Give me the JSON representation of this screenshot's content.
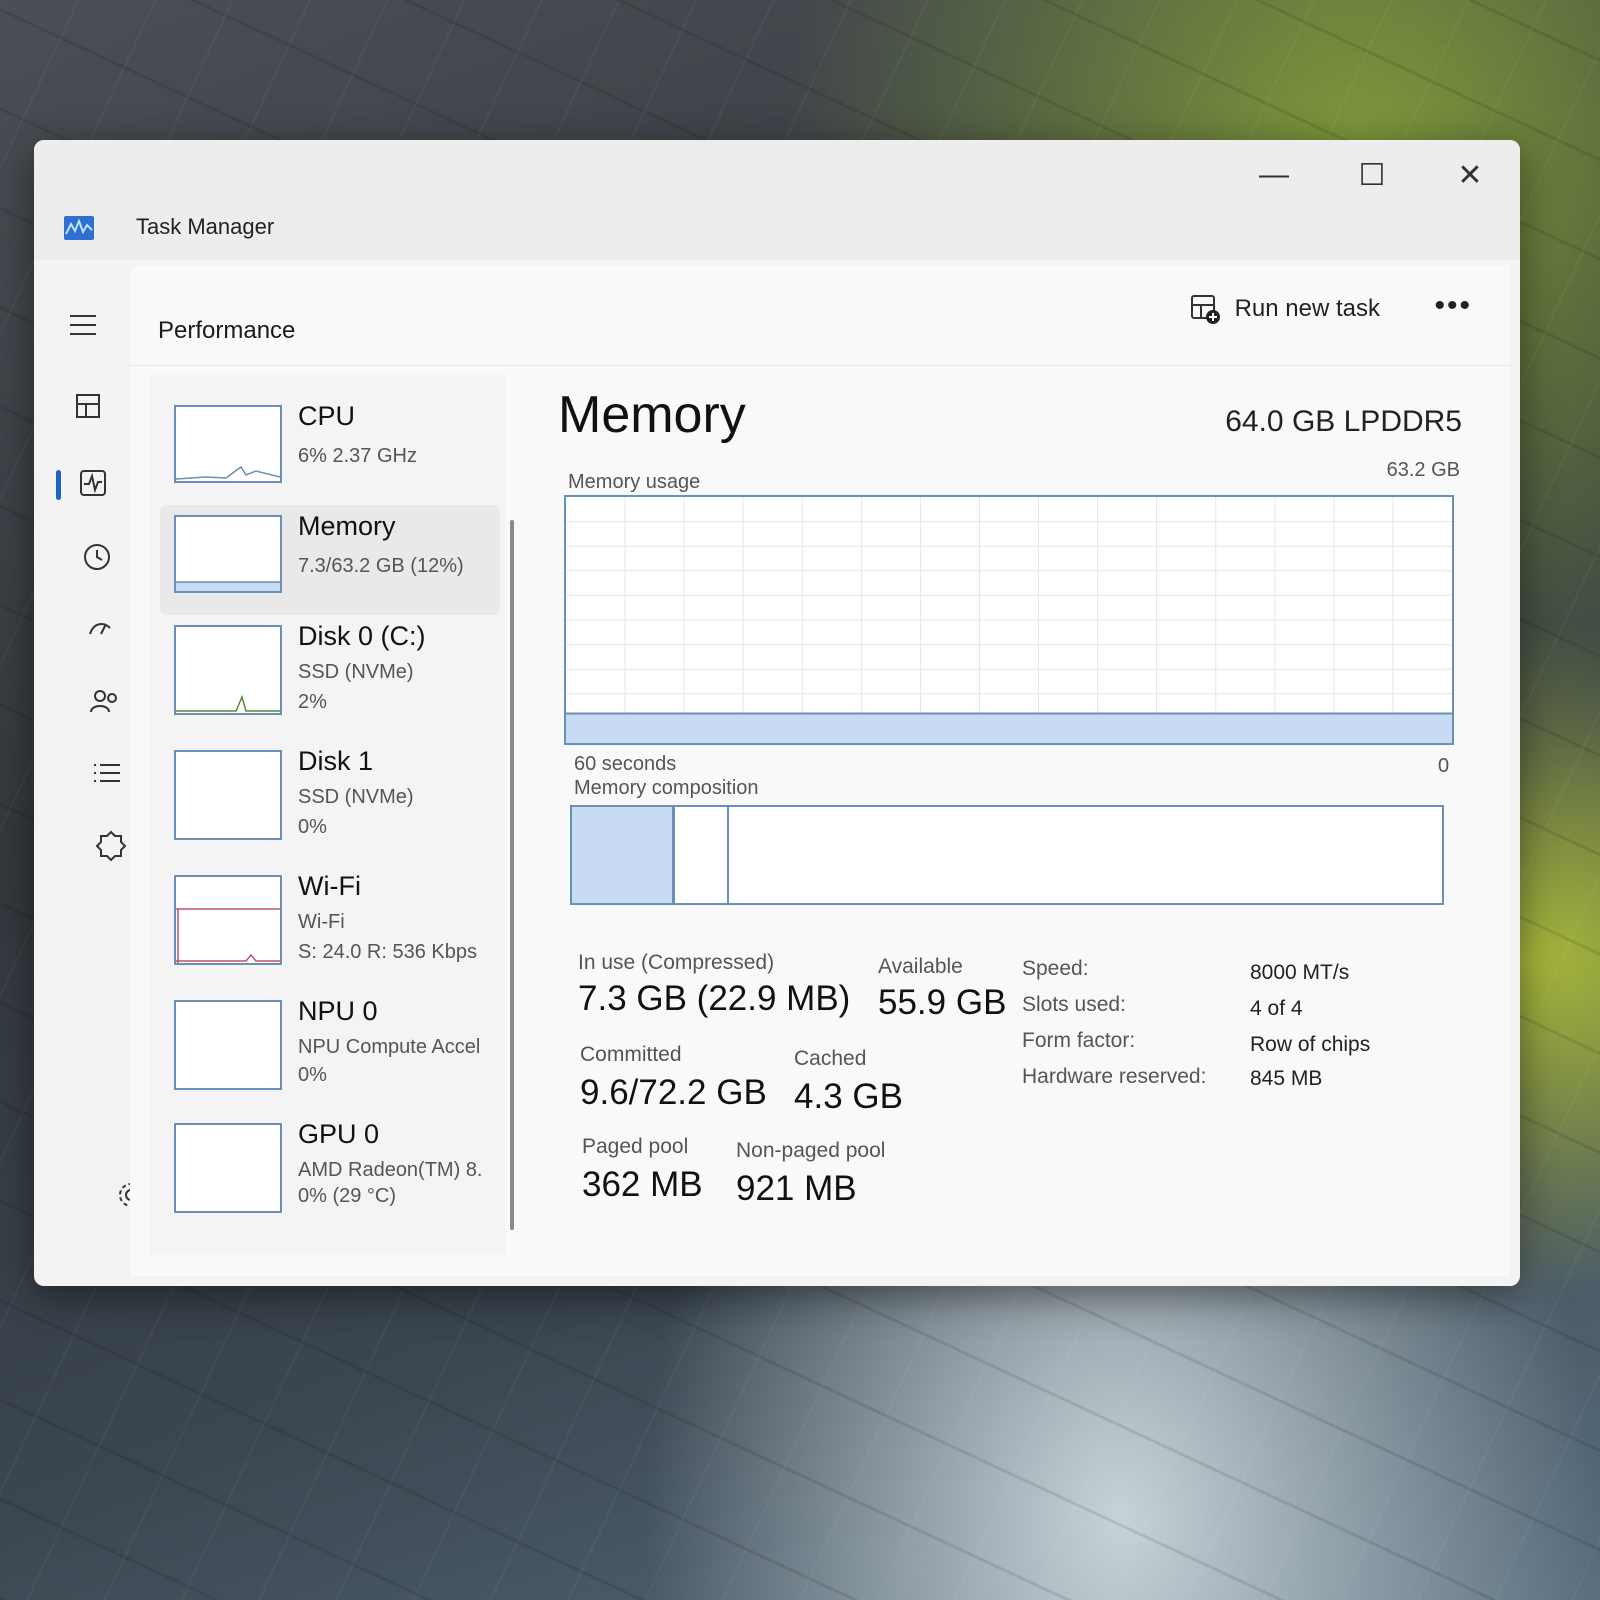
{
  "app": {
    "title": "Task Manager"
  },
  "window_controls": {
    "minimize": "—",
    "maximize": "☐",
    "close": "✕"
  },
  "toolbar": {
    "page_title": "Performance",
    "run_new_task": "Run new task",
    "more": "•••"
  },
  "nav": {
    "items": [
      {
        "name": "processes",
        "icon": "processes-icon"
      },
      {
        "name": "performance",
        "icon": "performance-icon",
        "active": true
      },
      {
        "name": "app-history",
        "icon": "app-history-icon"
      },
      {
        "name": "startup-apps",
        "icon": "startup-icon"
      },
      {
        "name": "users",
        "icon": "users-icon"
      },
      {
        "name": "details",
        "icon": "details-icon"
      },
      {
        "name": "services",
        "icon": "services-icon"
      }
    ],
    "settings_icon": "settings-icon"
  },
  "perf_list": [
    {
      "id": "cpu",
      "title": "CPU",
      "sub1": "6% 2.37 GHz",
      "sub2": ""
    },
    {
      "id": "memory",
      "title": "Memory",
      "sub1": "7.3/63.2 GB (12%)",
      "sub2": "",
      "selected": true
    },
    {
      "id": "disk0",
      "title": "Disk 0 (C:)",
      "sub1": "SSD (NVMe)",
      "sub2": "2%"
    },
    {
      "id": "disk1",
      "title": "Disk 1",
      "sub1": "SSD (NVMe)",
      "sub2": "0%"
    },
    {
      "id": "wifi",
      "title": "Wi-Fi",
      "sub1": "Wi-Fi",
      "sub2": "S: 24.0 R: 536 Kbps"
    },
    {
      "id": "npu0",
      "title": "NPU 0",
      "sub1": "NPU Compute Accel",
      "sub2": "0%"
    },
    {
      "id": "gpu0",
      "title": "GPU 0",
      "sub1": "AMD Radeon(TM) 8.",
      "sub2": "0% (29 °C)"
    }
  ],
  "memory": {
    "title": "Memory",
    "spec": "64.0 GB LPDDR5",
    "usage_label": "Memory usage",
    "usage_max": "63.2 GB",
    "time_left": "60 seconds",
    "time_right": "0",
    "composition_label": "Memory composition",
    "usage_fraction": 0.12,
    "composition": {
      "in_use_fraction": 0.115,
      "modified_fraction": 0.178
    },
    "stats": {
      "in_use_label": "In use (Compressed)",
      "in_use_value": "7.3 GB (22.9 MB)",
      "available_label": "Available",
      "available_value": "55.9 GB",
      "committed_label": "Committed",
      "committed_value": "9.6/72.2 GB",
      "cached_label": "Cached",
      "cached_value": "4.3 GB",
      "paged_label": "Paged pool",
      "paged_value": "362 MB",
      "nonpaged_label": "Non-paged pool",
      "nonpaged_value": "921 MB"
    },
    "details": {
      "speed_label": "Speed:",
      "speed_value": "8000 MT/s",
      "slots_label": "Slots used:",
      "slots_value": "4 of 4",
      "form_label": "Form factor:",
      "form_value": "Row of chips",
      "hw_label": "Hardware reserved:",
      "hw_value": "845 MB"
    }
  },
  "colors": {
    "accent": "#1f62c6",
    "graph_line": "#6a8fb8",
    "graph_fill": "#c7dbf3",
    "wifi_line": "#c0506a"
  }
}
